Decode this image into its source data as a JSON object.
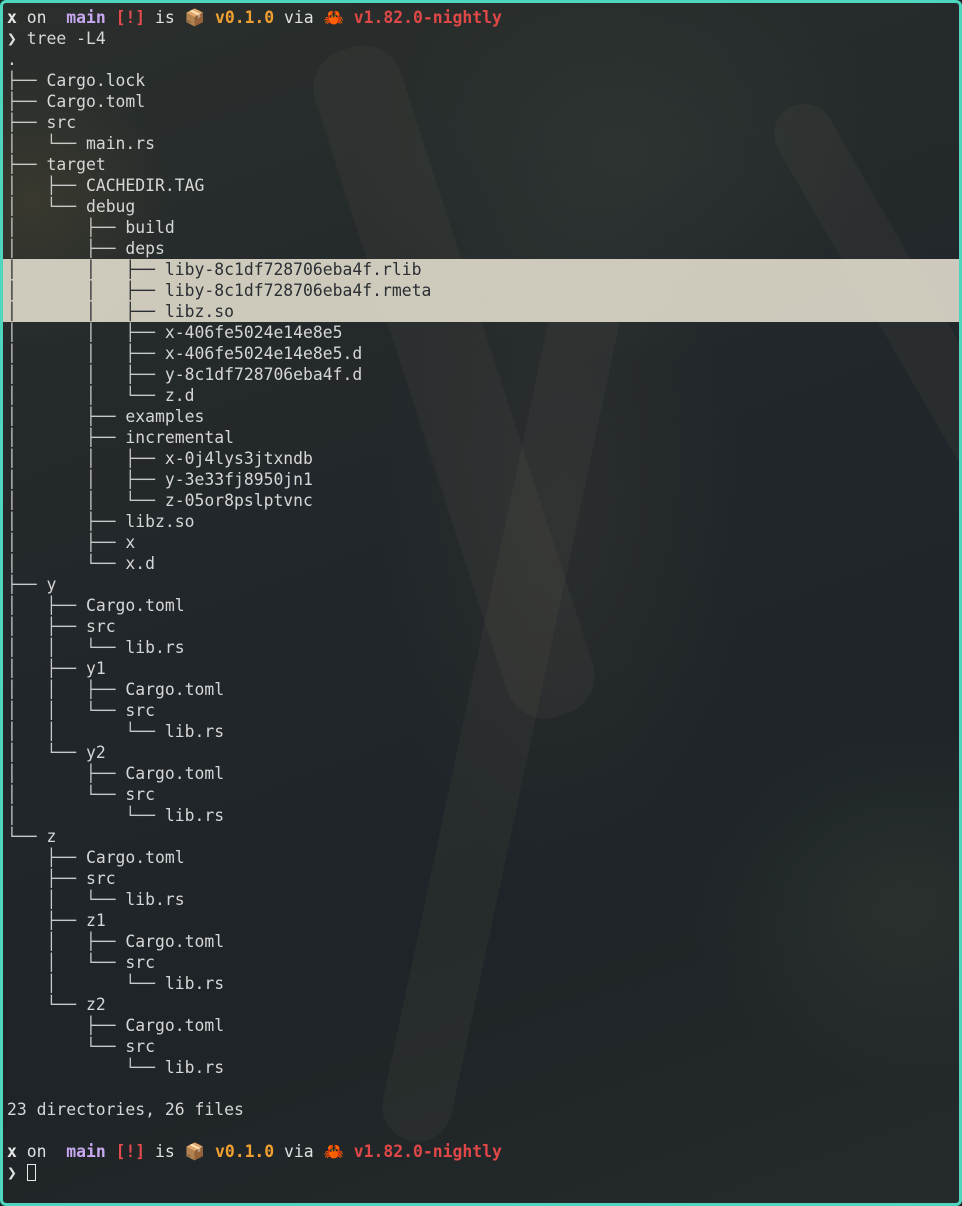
{
  "prompt1": {
    "user": "x",
    "on": " on ",
    "branch_icon": "",
    "branch": " main",
    "status": " [!]",
    "is": " is ",
    "package_icon": "📦",
    "version": " v0.1.0",
    "via": " via ",
    "rust_icon": "🦀",
    "rust_version": " v1.82.0-nightly"
  },
  "command": {
    "chevron": "❯",
    "text": " tree -L4"
  },
  "tree": [
    {
      "prefix": "",
      "name": ".",
      "highlight": false
    },
    {
      "prefix": "├── ",
      "name": "Cargo.lock",
      "highlight": false
    },
    {
      "prefix": "├── ",
      "name": "Cargo.toml",
      "highlight": false
    },
    {
      "prefix": "├── ",
      "name": "src",
      "highlight": false
    },
    {
      "prefix": "│   └── ",
      "name": "main.rs",
      "highlight": false
    },
    {
      "prefix": "├── ",
      "name": "target",
      "highlight": false
    },
    {
      "prefix": "│   ├── ",
      "name": "CACHEDIR.TAG",
      "highlight": false
    },
    {
      "prefix": "│   └── ",
      "name": "debug",
      "highlight": false
    },
    {
      "prefix": "│       ├── ",
      "name": "build",
      "highlight": false
    },
    {
      "prefix": "│       ├── ",
      "name": "deps",
      "highlight": false
    },
    {
      "prefix": "│       │   ├── ",
      "name": "liby-8c1df728706eba4f.rlib",
      "highlight": true
    },
    {
      "prefix": "│       │   ├── ",
      "name": "liby-8c1df728706eba4f.rmeta",
      "highlight": true
    },
    {
      "prefix": "│       │   ├── ",
      "name": "libz.so",
      "highlight": true
    },
    {
      "prefix": "│       │   ├── ",
      "name": "x-406fe5024e14e8e5",
      "highlight": false
    },
    {
      "prefix": "│       │   ├── ",
      "name": "x-406fe5024e14e8e5.d",
      "highlight": false
    },
    {
      "prefix": "│       │   ├── ",
      "name": "y-8c1df728706eba4f.d",
      "highlight": false
    },
    {
      "prefix": "│       │   └── ",
      "name": "z.d",
      "highlight": false
    },
    {
      "prefix": "│       ├── ",
      "name": "examples",
      "highlight": false
    },
    {
      "prefix": "│       ├── ",
      "name": "incremental",
      "highlight": false
    },
    {
      "prefix": "│       │   ├── ",
      "name": "x-0j4lys3jtxndb",
      "highlight": false
    },
    {
      "prefix": "│       │   ├── ",
      "name": "y-3e33fj8950jn1",
      "highlight": false
    },
    {
      "prefix": "│       │   └── ",
      "name": "z-05or8pslptvnc",
      "highlight": false
    },
    {
      "prefix": "│       ├── ",
      "name": "libz.so",
      "highlight": false
    },
    {
      "prefix": "│       ├── ",
      "name": "x",
      "highlight": false
    },
    {
      "prefix": "│       └── ",
      "name": "x.d",
      "highlight": false
    },
    {
      "prefix": "├── ",
      "name": "y",
      "highlight": false
    },
    {
      "prefix": "│   ├── ",
      "name": "Cargo.toml",
      "highlight": false
    },
    {
      "prefix": "│   ├── ",
      "name": "src",
      "highlight": false
    },
    {
      "prefix": "│   │   └── ",
      "name": "lib.rs",
      "highlight": false
    },
    {
      "prefix": "│   ├── ",
      "name": "y1",
      "highlight": false
    },
    {
      "prefix": "│   │   ├── ",
      "name": "Cargo.toml",
      "highlight": false
    },
    {
      "prefix": "│   │   └── ",
      "name": "src",
      "highlight": false
    },
    {
      "prefix": "│   │       └── ",
      "name": "lib.rs",
      "highlight": false
    },
    {
      "prefix": "│   └── ",
      "name": "y2",
      "highlight": false
    },
    {
      "prefix": "│       ├── ",
      "name": "Cargo.toml",
      "highlight": false
    },
    {
      "prefix": "│       └── ",
      "name": "src",
      "highlight": false
    },
    {
      "prefix": "│           └── ",
      "name": "lib.rs",
      "highlight": false
    },
    {
      "prefix": "└── ",
      "name": "z",
      "highlight": false
    },
    {
      "prefix": "    ├── ",
      "name": "Cargo.toml",
      "highlight": false
    },
    {
      "prefix": "    ├── ",
      "name": "src",
      "highlight": false
    },
    {
      "prefix": "    │   └── ",
      "name": "lib.rs",
      "highlight": false
    },
    {
      "prefix": "    ├── ",
      "name": "z1",
      "highlight": false
    },
    {
      "prefix": "    │   ├── ",
      "name": "Cargo.toml",
      "highlight": false
    },
    {
      "prefix": "    │   └── ",
      "name": "src",
      "highlight": false
    },
    {
      "prefix": "    │       └── ",
      "name": "lib.rs",
      "highlight": false
    },
    {
      "prefix": "    └── ",
      "name": "z2",
      "highlight": false
    },
    {
      "prefix": "        ├── ",
      "name": "Cargo.toml",
      "highlight": false
    },
    {
      "prefix": "        └── ",
      "name": "src",
      "highlight": false
    },
    {
      "prefix": "            └── ",
      "name": "lib.rs",
      "highlight": false
    }
  ],
  "summary": "23 directories, 26 files",
  "prompt2": {
    "user": "x",
    "on": " on ",
    "branch_icon": "",
    "branch": " main",
    "status": " [!]",
    "is": " is ",
    "package_icon": "📦",
    "version": " v0.1.0",
    "via": " via ",
    "rust_icon": "🦀",
    "rust_version": " v1.82.0-nightly"
  },
  "input": {
    "chevron": "❯",
    "text": ""
  },
  "colors": {
    "border": "#4fd6be",
    "highlight": "#e0dccc",
    "branch": "#c8a8f0",
    "status": "#e24b4b",
    "version": "#f0a030",
    "rust": "#e04848"
  }
}
